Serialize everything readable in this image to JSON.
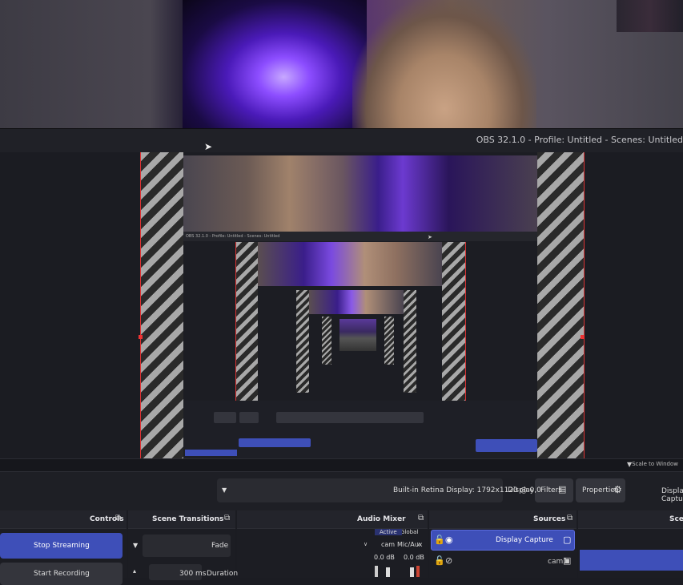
{
  "window": {
    "title": "OBS 32.1.0 - Profile: Untitled - Scenes: Untitled"
  },
  "preview": {
    "nested_title": "OBS 32.1.0 - Profile: Untitled - Scenes: Untitled"
  },
  "scale_bar": {
    "label": "Scale to Window"
  },
  "toolbar": {
    "source_label": "Display Capture",
    "properties_label": "Properties",
    "filters_label": "Filters",
    "display_label": "Display",
    "display_value": "Built-in Retina Display: 1792x1120 @ 0,0"
  },
  "docks": {
    "scenes": {
      "title": "Scenes"
    },
    "sources": {
      "title": "Sources",
      "items": [
        {
          "label": "Display Capture",
          "selected": true
        },
        {
          "label": "cam1",
          "selected": false
        }
      ]
    },
    "audio_mixer": {
      "title": "Audio Mixer",
      "tab_global": "Global",
      "tab_active": "Active",
      "channels": [
        {
          "name": "Mic/Aux",
          "db": "0.0 dB"
        },
        {
          "name": "cam",
          "db": "0.0 dB"
        }
      ]
    },
    "scene_transitions": {
      "title": "Scene Transitions",
      "transition": "Fade",
      "duration_label": "Duration",
      "duration_value": "300 ms"
    },
    "controls": {
      "title": "Controls",
      "stop_streaming": "Stop Streaming",
      "start_recording": "Start Recording"
    }
  },
  "colors": {
    "accent": "#3e4fb8",
    "background": "#1c1d23",
    "stripe_light": "#a8a8a8",
    "bounds_red": "#dd3333"
  }
}
